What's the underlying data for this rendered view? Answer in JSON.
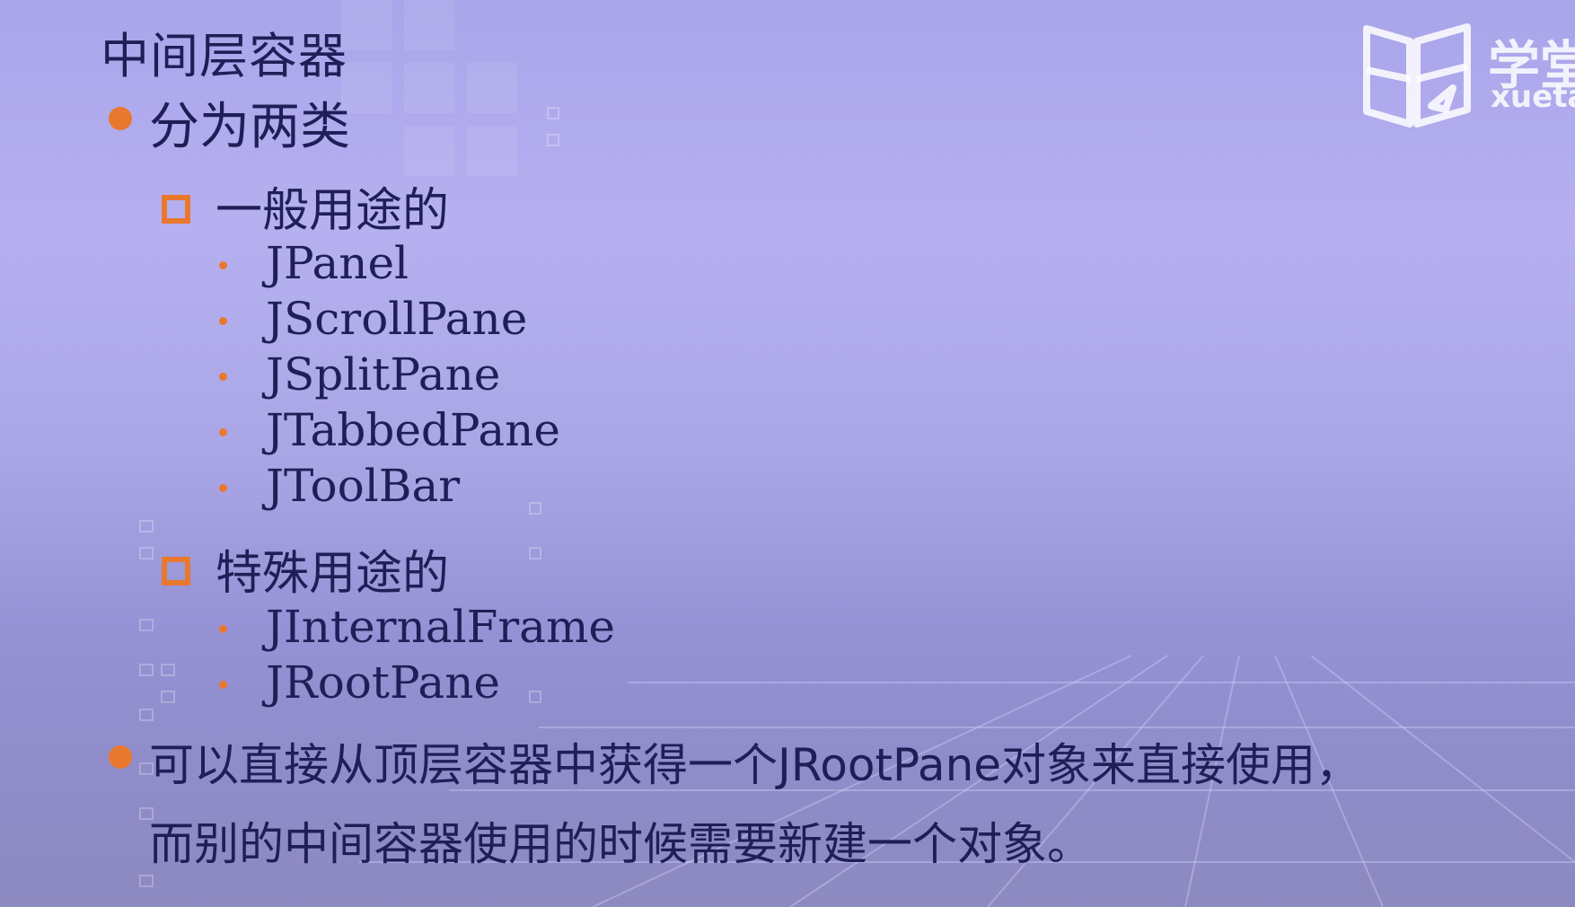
{
  "slide": {
    "title": "中间层容器",
    "bullet1": "分为两类",
    "group1": {
      "heading": "一般用途的",
      "items": [
        "JPanel",
        "JScrollPane",
        "JSplitPane",
        "JTabbedPane",
        "JToolBar"
      ]
    },
    "group2": {
      "heading": "特殊用途的",
      "items": [
        "JInternalFrame",
        "JRootPane"
      ]
    },
    "bullet2_line1": "可以直接从顶层容器中获得一个JRootPane对象来直接使用，",
    "bullet2_line2": "而别的中间容器使用的时候需要新建一个对象。"
  },
  "logo": {
    "text": "学堂",
    "subtext": "xuetang",
    "icon": "book-logo-icon"
  },
  "colors": {
    "text": "#1f1f57",
    "accent": "#e9782f",
    "background": "#b0abee"
  }
}
